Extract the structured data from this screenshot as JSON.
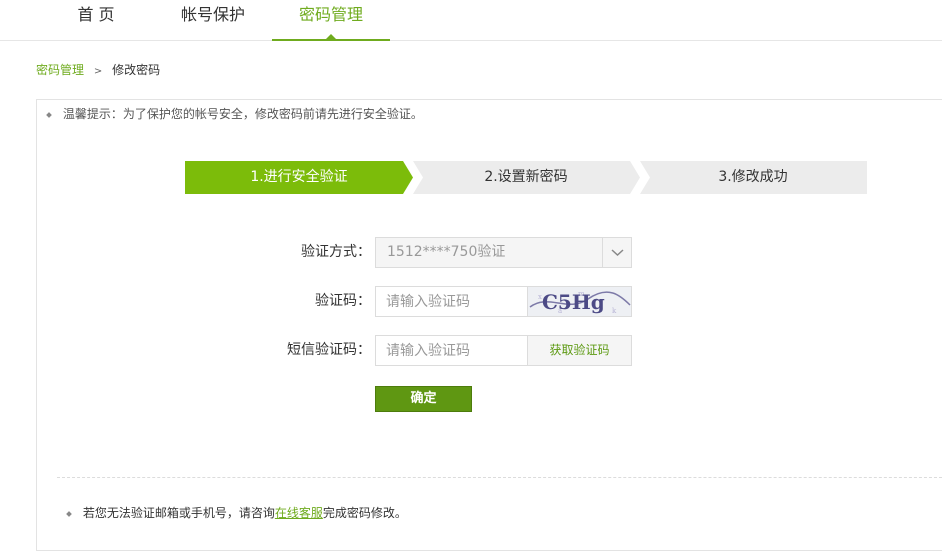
{
  "nav": {
    "tabs": [
      {
        "label": "首 页"
      },
      {
        "label": "帐号保护"
      },
      {
        "label": "密码管理"
      }
    ],
    "active_color": "#6fab1e"
  },
  "breadcrumb": {
    "parent": "密码管理",
    "separator": ">",
    "current": "修改密码"
  },
  "tip": "温馨提示：为了保护您的帐号安全，修改密码前请先进行安全验证。",
  "steps": [
    {
      "label": "1.进行安全验证",
      "state": "active"
    },
    {
      "label": "2.设置新密码",
      "state": "pending"
    },
    {
      "label": "3.修改成功",
      "state": "pending"
    }
  ],
  "form": {
    "method_label": "验证方式：",
    "method_value": "1512****750验证",
    "captcha_label": "验证码：",
    "captcha_placeholder": "请输入验证码",
    "captcha_text": "C5Hg",
    "sms_label": "短信验证码：",
    "sms_placeholder": "请输入验证码",
    "sms_button": "获取验证码",
    "confirm_button": "确定"
  },
  "footer": {
    "before": "若您无法验证邮箱或手机号，请咨询",
    "link": "在线客服",
    "after": "完成密码修改。"
  },
  "colors": {
    "step_active": "#7cbc0a",
    "step_pending": "#ececec",
    "button": "#5f9712"
  }
}
